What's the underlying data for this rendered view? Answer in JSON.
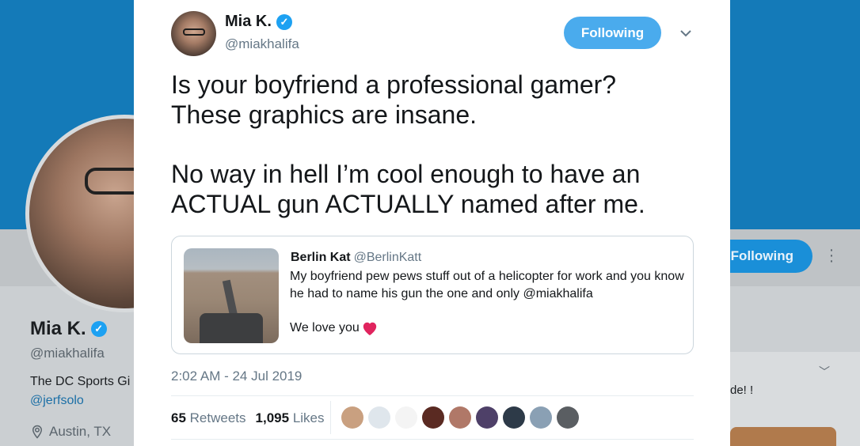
{
  "background": {
    "profile_name": "Mia K.",
    "profile_handle": "@miakhalifa",
    "bio": "The DC Sports Gi",
    "bio_link": "@jerfsolo",
    "location": "Austin, TX",
    "following_label": "Following",
    "panel_text": "de! !"
  },
  "tweet": {
    "author_name": "Mia K.",
    "author_handle": "@miakhalifa",
    "follow_label": "Following",
    "text_para1_line1": "Is your boyfriend a professional gamer?",
    "text_para1_line2": "These graphics are insane.",
    "text_para2_line1": "No way in hell I’m cool enough to have an",
    "text_para2_line2": "ACTUAL gun ACTUALLY named after me.",
    "quote": {
      "author_name": "Berlin Kat",
      "author_handle": "@BerlinKatt",
      "text": "My boyfriend pew pews stuff out of a helicopter for work and you know he had to name his gun the one and only  @miakhalifa",
      "closing": "We love you"
    },
    "timestamp": "2:02 AM - 24 Jul 2019",
    "retweets_count": "65",
    "retweets_label": "Retweets",
    "likes_count": "1,095",
    "likes_label": "Likes"
  },
  "colors": {
    "accent": "#1da1f2",
    "follow_button": "#4aabed",
    "heart": "#e0245e"
  }
}
